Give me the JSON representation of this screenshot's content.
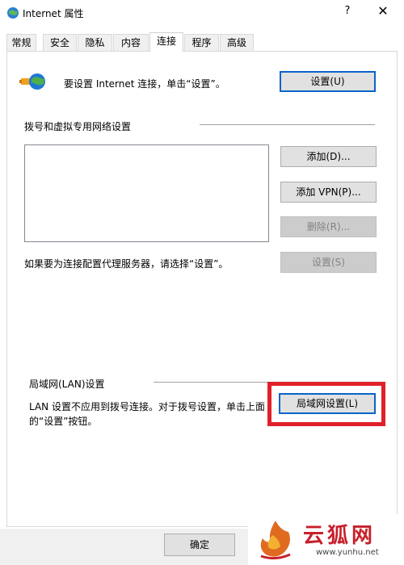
{
  "window": {
    "title": "Internet 属性",
    "help_label": "?",
    "close_label": "✕"
  },
  "tabs": [
    {
      "label": "常规"
    },
    {
      "label": "安全"
    },
    {
      "label": "隐私"
    },
    {
      "label": "内容"
    },
    {
      "label": "连接",
      "active": true
    },
    {
      "label": "程序"
    },
    {
      "label": "高级"
    }
  ],
  "setup": {
    "text": "要设置 Internet 连接，单击“设置”。",
    "button_label": "设置(U)"
  },
  "dialup": {
    "section_label": "拨号和虚拟专用网络设置",
    "add_button": "添加(D)...",
    "add_vpn_button": "添加 VPN(P)...",
    "delete_button": "删除(R)...",
    "proxy_text": "如果要为连接配置代理服务器，请选择“设置”。",
    "settings_button": "设置(S)"
  },
  "lan": {
    "section_label": "局域网(LAN)设置",
    "text": "LAN 设置不应用到拨号连接。对于拨号设置，单击上面的“设置”按钮。",
    "button_label": "局域网设置(L)"
  },
  "footer": {
    "ok_button": "确定"
  },
  "watermark": {
    "brand": "云狐网",
    "url": "www.yunhu.net"
  },
  "colors": {
    "highlight": "#e0202a",
    "primary_border": "#0a64c8"
  }
}
